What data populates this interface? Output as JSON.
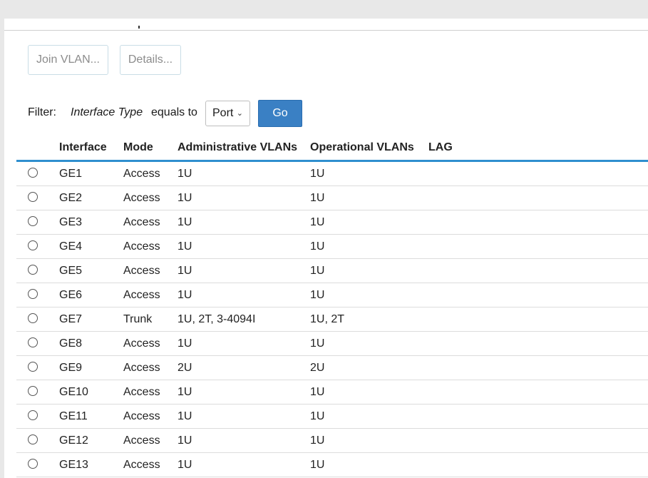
{
  "toolbar": {
    "join_vlan_label": "Join VLAN...",
    "details_label": "Details..."
  },
  "filter": {
    "label": "Filter:",
    "field": "Interface Type",
    "operator": "equals to",
    "selected_value": "Port",
    "go_label": "Go"
  },
  "table": {
    "headers": {
      "interface": "Interface",
      "mode": "Mode",
      "admin_vlans": "Administrative VLANs",
      "oper_vlans": "Operational VLANs",
      "lag": "LAG"
    },
    "rows": [
      {
        "interface": "GE1",
        "mode": "Access",
        "admin_vlans": "1U",
        "oper_vlans": "1U",
        "lag": ""
      },
      {
        "interface": "GE2",
        "mode": "Access",
        "admin_vlans": "1U",
        "oper_vlans": "1U",
        "lag": ""
      },
      {
        "interface": "GE3",
        "mode": "Access",
        "admin_vlans": "1U",
        "oper_vlans": "1U",
        "lag": ""
      },
      {
        "interface": "GE4",
        "mode": "Access",
        "admin_vlans": "1U",
        "oper_vlans": "1U",
        "lag": ""
      },
      {
        "interface": "GE5",
        "mode": "Access",
        "admin_vlans": "1U",
        "oper_vlans": "1U",
        "lag": ""
      },
      {
        "interface": "GE6",
        "mode": "Access",
        "admin_vlans": "1U",
        "oper_vlans": "1U",
        "lag": ""
      },
      {
        "interface": "GE7",
        "mode": "Trunk",
        "admin_vlans": "1U, 2T, 3-4094I",
        "oper_vlans": "1U, 2T",
        "lag": ""
      },
      {
        "interface": "GE8",
        "mode": "Access",
        "admin_vlans": "1U",
        "oper_vlans": "1U",
        "lag": ""
      },
      {
        "interface": "GE9",
        "mode": "Access",
        "admin_vlans": "2U",
        "oper_vlans": "2U",
        "lag": ""
      },
      {
        "interface": "GE10",
        "mode": "Access",
        "admin_vlans": "1U",
        "oper_vlans": "1U",
        "lag": ""
      },
      {
        "interface": "GE11",
        "mode": "Access",
        "admin_vlans": "1U",
        "oper_vlans": "1U",
        "lag": ""
      },
      {
        "interface": "GE12",
        "mode": "Access",
        "admin_vlans": "1U",
        "oper_vlans": "1U",
        "lag": ""
      },
      {
        "interface": "GE13",
        "mode": "Access",
        "admin_vlans": "1U",
        "oper_vlans": "1U",
        "lag": ""
      }
    ]
  },
  "colors": {
    "accent": "#2f8fcf",
    "go_button": "#3a80c4",
    "disabled_border": "#c9dde6"
  }
}
